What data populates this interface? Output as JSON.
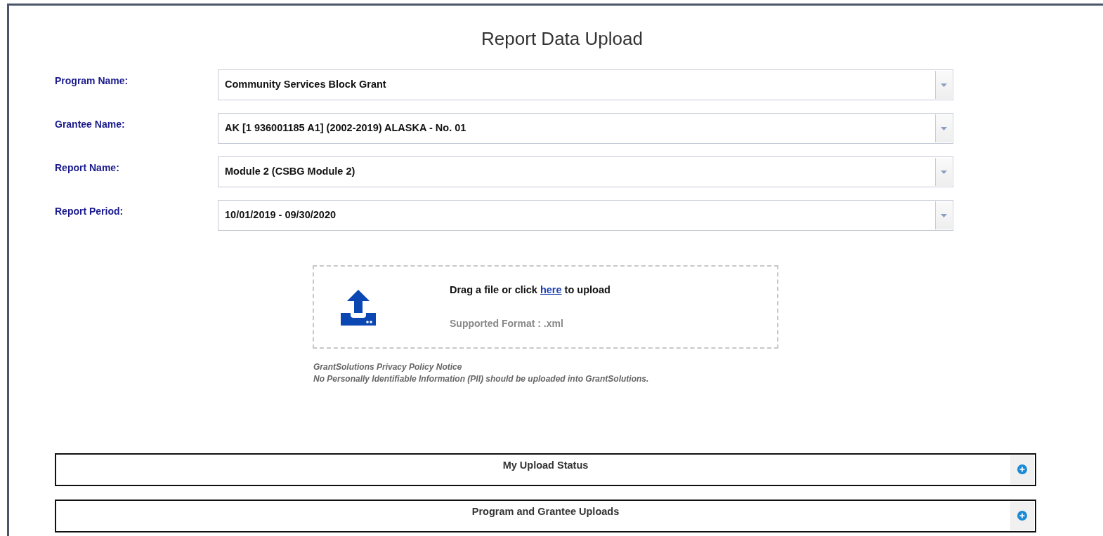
{
  "title": "Report Data Upload",
  "fields": [
    {
      "label": "Program Name:",
      "value": "Community Services Block Grant"
    },
    {
      "label": "Grantee Name:",
      "value": "AK [1 936001185 A1] (2002-2019) ALASKA - No. 01"
    },
    {
      "label": "Report Name:",
      "value": "Module 2 (CSBG Module 2)"
    },
    {
      "label": "Report Period:",
      "value": "10/01/2019 - 09/30/2020"
    }
  ],
  "upload": {
    "before": "Drag a file or click ",
    "link": "here",
    "after": " to upload",
    "format": "Supported Format : .xml"
  },
  "privacy": {
    "title": "GrantSolutions Privacy Policy Notice",
    "text": "No Personally Identifiable Information (PII) should be uploaded into GrantSolutions."
  },
  "sections": [
    {
      "title": "My Upload Status",
      "expanded": false
    },
    {
      "title": "Program and Grantee Uploads",
      "expanded": false
    }
  ]
}
